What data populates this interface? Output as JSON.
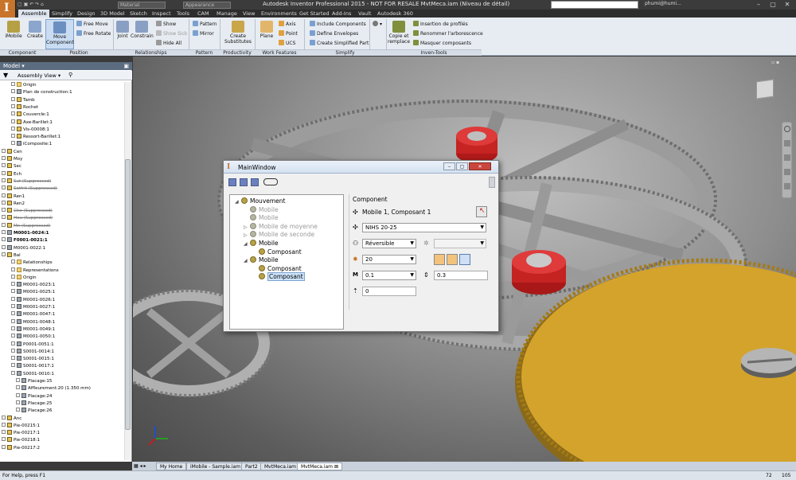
{
  "app": {
    "title": "Autodesk Inventor Professional 2015 - NOT FOR RESALE   MvtMeca.iam (Niveau de détail)",
    "material_placeholder": "Material",
    "appearance_placeholder": "Appearance",
    "user": "phumi@humi..."
  },
  "tabs": [
    "Assemble",
    "Simplify",
    "Design",
    "3D Model",
    "Sketch",
    "Inspect",
    "Tools",
    "CAM",
    "Manage",
    "View",
    "Environments",
    "Get Started",
    "Add-Ins",
    "Vault",
    "Autodesk 360"
  ],
  "ribbon": {
    "imobile": "iMobile",
    "create": "Create",
    "move_component": "Move Component",
    "free_move": "Free Move",
    "free_rotate": "Free Rotate",
    "joint": "Joint",
    "constrain": "Constrain",
    "show": "Show",
    "show_sick": "Show Sick",
    "hide_all": "Hide All",
    "pattern": "Pattern",
    "mirror": "Mirror",
    "create_substitutes": "Create Substitutes",
    "plane": "Plane",
    "axis": "Axis",
    "point": "Point",
    "ucs": "UCS",
    "include_components": "Include Components",
    "define_envelopes": "Define Envelopes",
    "create_simplified_part": "Create Simplified Part",
    "copie_remplace": "Copie et remplace",
    "insertion_profiles": "Insertion de profilés",
    "renommer": "Renommer l'arborescence",
    "masquer": "Masquer composants",
    "groups": {
      "component": "Component",
      "position": "Position",
      "relationships": "Relationships",
      "pattern": "Pattern",
      "productivity": "Productivity",
      "work_features": "Work Features",
      "simplify": "Simplify",
      "inven_tools": "Inven-Tools"
    }
  },
  "model_panel": {
    "title": "Model",
    "view": "Assembly View",
    "tree": [
      {
        "label": "Origin",
        "indent": 2,
        "icon": "folder"
      },
      {
        "label": "Plan de construction:1",
        "indent": 2,
        "icon": "part"
      },
      {
        "label": "Tamb",
        "indent": 2,
        "icon": "asm"
      },
      {
        "label": "Rochet",
        "indent": 2,
        "icon": "asm"
      },
      {
        "label": "Couvercle:1",
        "indent": 2,
        "icon": "asm"
      },
      {
        "label": "Axe-Barillet:1",
        "indent": 2,
        "icon": "asm"
      },
      {
        "label": "Vis-00008:1",
        "indent": 2,
        "icon": "asm"
      },
      {
        "label": "Ressort-Barillet:1",
        "indent": 2,
        "icon": "asm"
      },
      {
        "label": "iComposite:1",
        "indent": 2,
        "icon": "part"
      },
      {
        "label": "Cen",
        "indent": 0,
        "icon": "asm"
      },
      {
        "label": "Moy",
        "indent": 0,
        "icon": "asm"
      },
      {
        "label": "Sec",
        "indent": 0,
        "icon": "asm"
      },
      {
        "label": "Ech",
        "indent": 0,
        "icon": "asm"
      },
      {
        "label": "Sut (Suppressed)",
        "indent": 0,
        "icon": "asm",
        "state": "sup"
      },
      {
        "label": "Sotfrit (Suppressed)",
        "indent": 0,
        "icon": "asm",
        "state": "sup"
      },
      {
        "label": "Ren1",
        "indent": 0,
        "icon": "asm"
      },
      {
        "label": "Ren2",
        "indent": 0,
        "icon": "asm"
      },
      {
        "label": "Cho (Suppressed)",
        "indent": 0,
        "icon": "asm",
        "state": "sup"
      },
      {
        "label": "Heu (Suppressed)",
        "indent": 0,
        "icon": "asm",
        "state": "sup"
      },
      {
        "label": "Mn (Suppressed)",
        "indent": 0,
        "icon": "asm",
        "state": "sup"
      },
      {
        "label": "M0001-0024:1",
        "indent": 0,
        "icon": "part",
        "state": "bold"
      },
      {
        "label": "F0001-0021:1",
        "indent": 0,
        "icon": "part",
        "state": "bold"
      },
      {
        "label": "M0001-0022:1",
        "indent": 0,
        "icon": "part"
      },
      {
        "label": "Bal",
        "indent": 0,
        "icon": "asm"
      },
      {
        "label": "Relationships",
        "indent": 2,
        "icon": "folder"
      },
      {
        "label": "Representations",
        "indent": 2,
        "icon": "folder"
      },
      {
        "label": "Origin",
        "indent": 2,
        "icon": "folder"
      },
      {
        "label": "M0001-0023:1",
        "indent": 2,
        "icon": "part"
      },
      {
        "label": "M0001-0025:1",
        "indent": 2,
        "icon": "part"
      },
      {
        "label": "M0001-0026:1",
        "indent": 2,
        "icon": "part"
      },
      {
        "label": "M0001-0027:1",
        "indent": 2,
        "icon": "part"
      },
      {
        "label": "M0001-0047:1",
        "indent": 2,
        "icon": "part"
      },
      {
        "label": "M0001-0048:1",
        "indent": 2,
        "icon": "part"
      },
      {
        "label": "M0001-0049:1",
        "indent": 2,
        "icon": "part"
      },
      {
        "label": "M0001-0050:1",
        "indent": 2,
        "icon": "part"
      },
      {
        "label": "P0001-0051:1",
        "indent": 2,
        "icon": "part"
      },
      {
        "label": "S0001-0014:1",
        "indent": 2,
        "icon": "part"
      },
      {
        "label": "S0001-0015:1",
        "indent": 2,
        "icon": "part"
      },
      {
        "label": "S0001-0017:1",
        "indent": 2,
        "icon": "part"
      },
      {
        "label": "S0001-0010:1",
        "indent": 2,
        "icon": "part"
      },
      {
        "label": "Placage:15",
        "indent": 3,
        "icon": "part"
      },
      {
        "label": "Affleurement:20 (1.350 mm)",
        "indent": 3,
        "icon": "part"
      },
      {
        "label": "Placage:24",
        "indent": 3,
        "icon": "part"
      },
      {
        "label": "Placage:25",
        "indent": 3,
        "icon": "part"
      },
      {
        "label": "Placage:26",
        "indent": 3,
        "icon": "part"
      },
      {
        "label": "Anc",
        "indent": 0,
        "icon": "asm"
      },
      {
        "label": "Pie-00215:1",
        "indent": 0,
        "icon": "asm"
      },
      {
        "label": "Pie-00217:1",
        "indent": 0,
        "icon": "asm"
      },
      {
        "label": "Pie-00218:1",
        "indent": 0,
        "icon": "asm"
      },
      {
        "label": "Pie-00217:2",
        "indent": 0,
        "icon": "asm"
      }
    ]
  },
  "mainwindow": {
    "title": "MainWindow",
    "tree": [
      {
        "label": "Mouvement",
        "level": 0,
        "tri": "◢",
        "disabled": false
      },
      {
        "label": "Mobile",
        "level": 1,
        "tri": "",
        "disabled": true
      },
      {
        "label": "Mobile",
        "level": 1,
        "tri": "",
        "disabled": true
      },
      {
        "label": "Mobile de moyenne",
        "level": 1,
        "tri": "▷",
        "disabled": true
      },
      {
        "label": "Mobile de seconde",
        "level": 1,
        "tri": "▷",
        "disabled": true
      },
      {
        "label": "Mobile",
        "level": 1,
        "tri": "◢",
        "disabled": false
      },
      {
        "label": "Composant",
        "level": 2,
        "tri": "",
        "disabled": false
      },
      {
        "label": "Mobile",
        "level": 1,
        "tri": "◢",
        "disabled": false
      },
      {
        "label": "Composant",
        "level": 2,
        "tri": "",
        "disabled": false
      },
      {
        "label": "Composant",
        "level": 2,
        "tri": "",
        "disabled": false,
        "selected": true
      }
    ],
    "component": {
      "header": "Component",
      "name": "Mobile 1, Composant 1",
      "ref": "NIHS 20-25",
      "mode": "Réversible",
      "teeth": "20",
      "module": "0.1",
      "diameter": "0.3",
      "offset": "0"
    }
  },
  "doctabs": [
    "My Home",
    "iMobile - Sample.iam",
    "Part2",
    "MvtMeca.iam",
    "MvtMeca.iam"
  ],
  "status": {
    "help": "For Help, press F1",
    "n1": "72",
    "n2": "105"
  }
}
